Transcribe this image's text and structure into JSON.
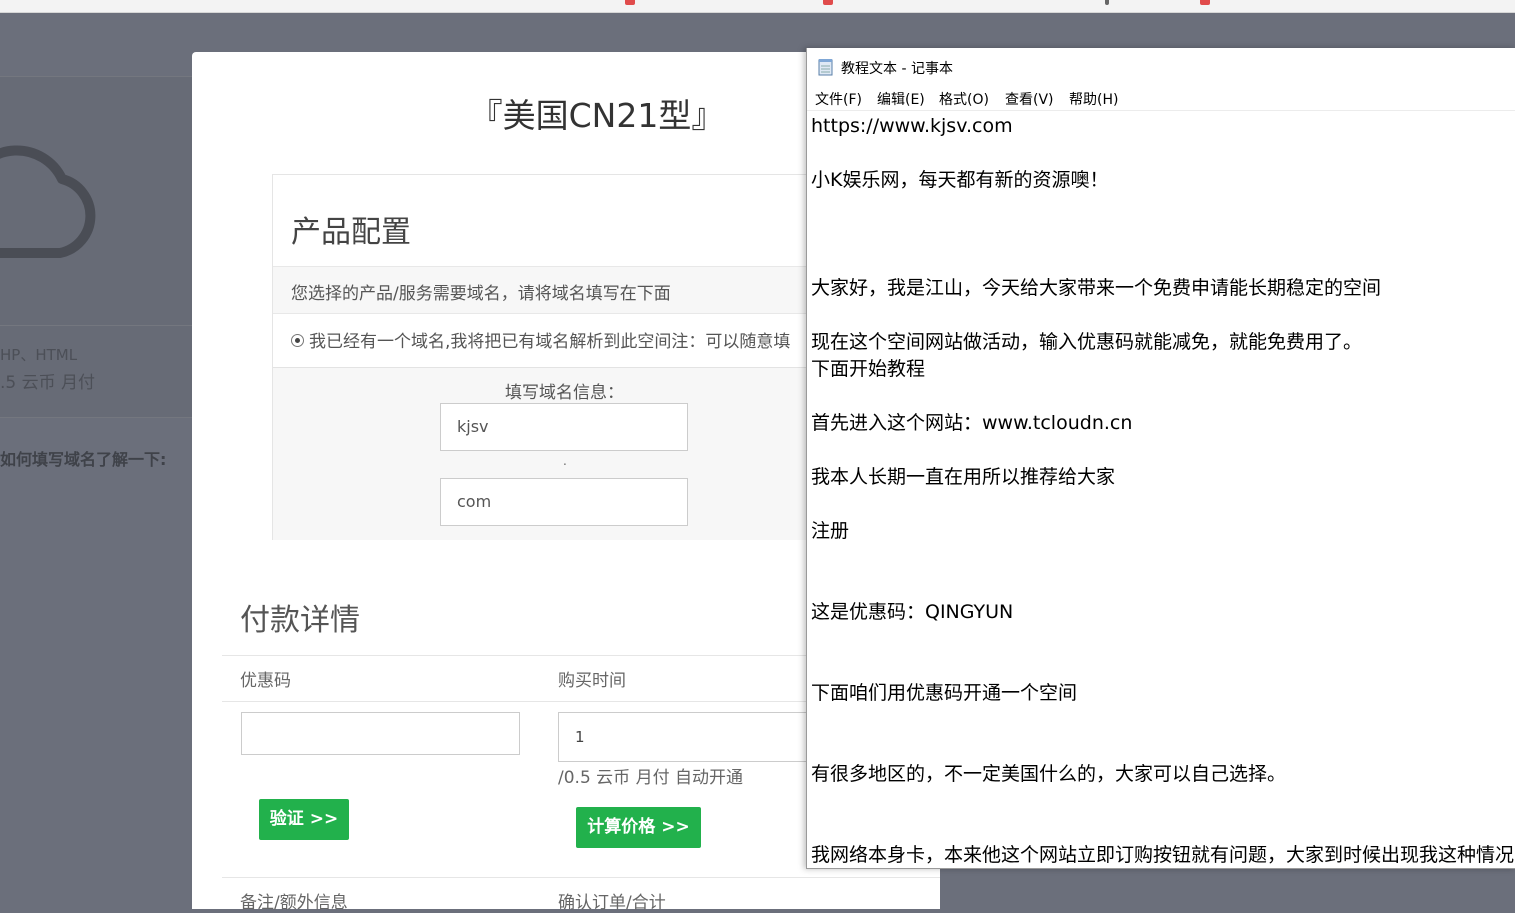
{
  "background": {
    "stack_text": "HP、HTML",
    "price_text": ".5 云币 月付",
    "help_text": "如何填写域名了解一下:"
  },
  "card": {
    "title": "『美国CN21型』",
    "config": {
      "heading": "产品配置",
      "description": "您选择的产品/服务需要域名，请将域名填写在下面",
      "radio_label": "我已经有一个域名,我将把已有域名解析到此空间注：可以随意填",
      "domain_label": "填写域名信息：",
      "domain_name": "kjsv",
      "separator": ".",
      "domain_tld": "com"
    },
    "payment": {
      "heading": "付款详情",
      "coupon_label": "优惠码",
      "coupon_value": "",
      "period_label": "购买时间",
      "period_value": "1",
      "price_note": "/0.5 云币 月付 自动开通",
      "verify_button": "验证 >>",
      "calc_button": "计算价格 >>",
      "notes_label": "备注/额外信息",
      "confirm_label": "确认订单/合计"
    }
  },
  "notepad": {
    "title": "教程文本 - 记事本",
    "menu": [
      "文件(F)",
      "编辑(E)",
      "格式(O)",
      "查看(V)",
      "帮助(H)"
    ],
    "lines": [
      "https://www.kjsv.com",
      "小K娱乐网，每天都有新的资源噢！",
      "大家好，我是江山，今天给大家带来一个免费申请能长期稳定的空间",
      "现在这个空间网站做活动，输入优惠码就能减免，就能免费用了。",
      "下面开始教程",
      "首先进入这个网站：www.tcloudn.cn",
      "我本人长期一直在用所以推荐给大家",
      "注册",
      "这是优惠码：QINGYUN",
      "下面咱们用优惠码开通一个空间",
      "有很多地区的，不一定美国什么的，大家可以自己选择。",
      "我网络本身卡，本来他这个网站立即订购按钮就有问题，大家到时候出现我这种情况"
    ]
  },
  "colors": {
    "overlay": "#6b6f7b",
    "accent_green": "#22b14c",
    "card_bg": "#ffffff"
  }
}
